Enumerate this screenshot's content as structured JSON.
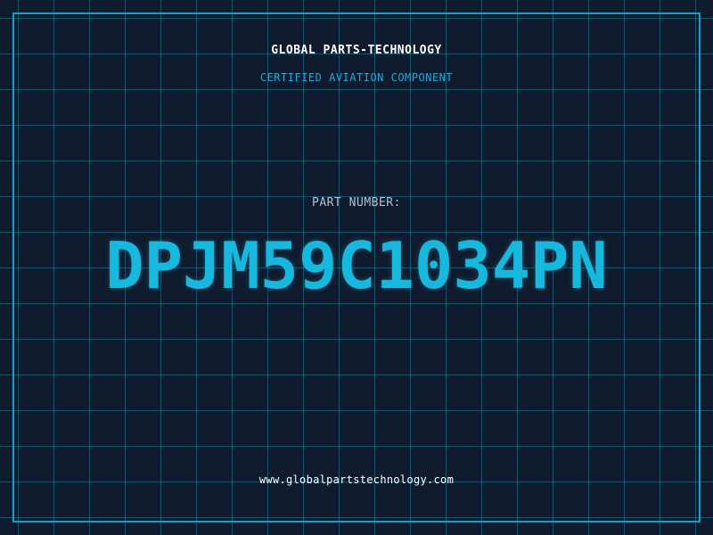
{
  "header": {
    "company": "GLOBAL PARTS-TECHNOLOGY",
    "subtitle": "CERTIFIED AVIATION COMPONENT"
  },
  "main": {
    "label": "PART NUMBER:",
    "part_number": "DPJM59C1034PN"
  },
  "footer": {
    "website": "www.globalpartstechnology.com"
  },
  "colors": {
    "background": "#101b2e",
    "grid": "#1e82a0",
    "frame": "#1aa0c8",
    "accent": "#17b8de",
    "subtitle": "#27a9d9",
    "label": "#b7c0cc",
    "text": "#ffffff"
  }
}
